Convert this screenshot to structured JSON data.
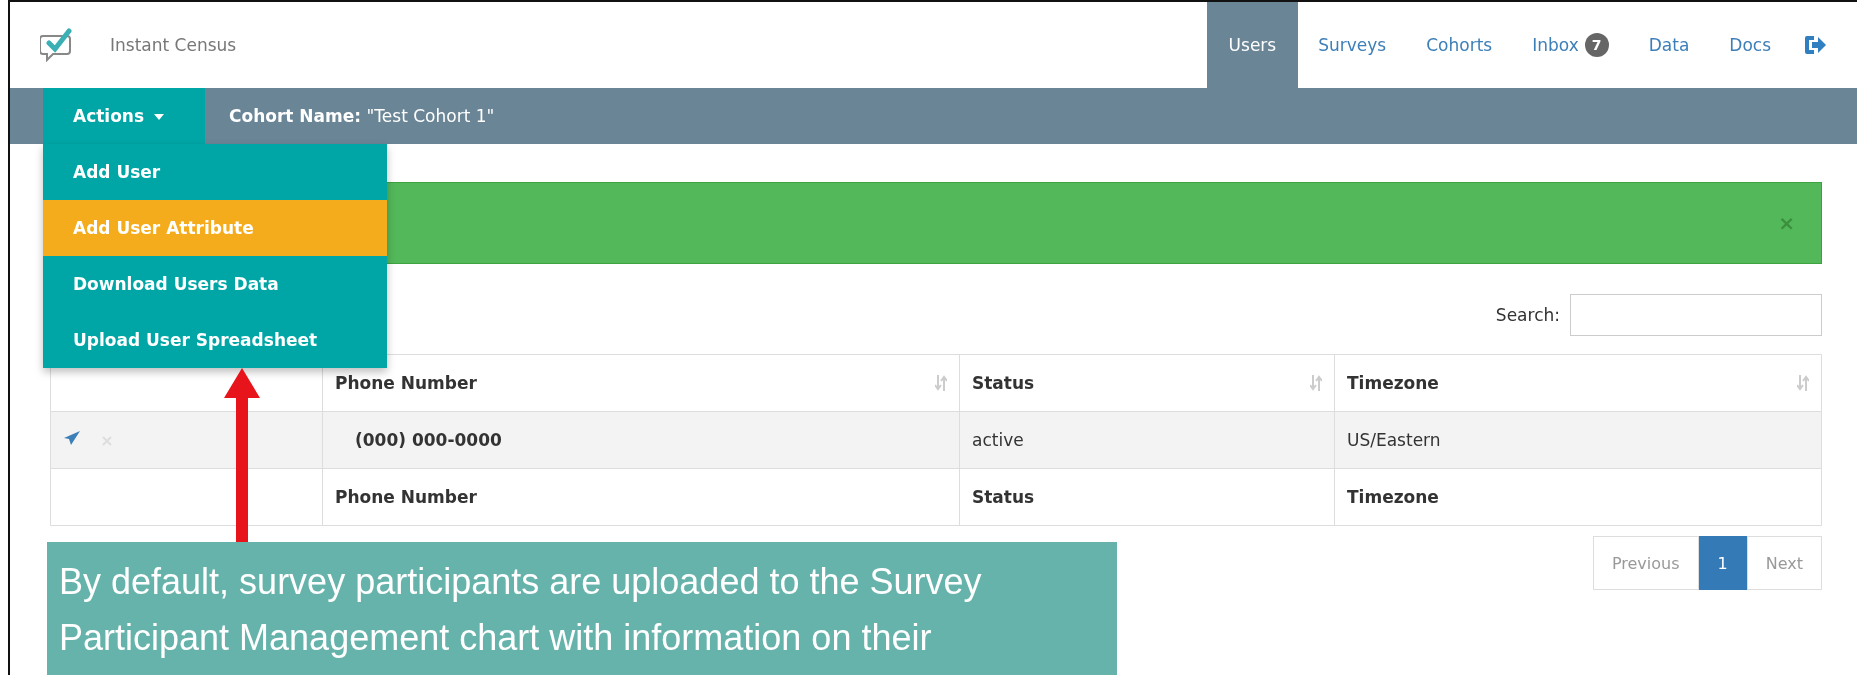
{
  "header": {
    "brand": "Instant Census"
  },
  "nav": [
    {
      "label": "Users",
      "selected": true
    },
    {
      "label": "Surveys",
      "selected": false
    },
    {
      "label": "Cohorts",
      "selected": false
    },
    {
      "label": "Inbox",
      "selected": false,
      "badge": "7"
    },
    {
      "label": "Data",
      "selected": false
    },
    {
      "label": "Docs",
      "selected": false
    }
  ],
  "subbar": {
    "actions": "Actions",
    "cohort_label": "Cohort Name:",
    "cohort_value": "\"Test Cohort 1\""
  },
  "actions_menu": [
    {
      "label": "Add User",
      "selected": false
    },
    {
      "label": "Add User Attribute",
      "selected": true
    },
    {
      "label": "Download Users Data",
      "selected": false
    },
    {
      "label": "Upload User Spreadsheet",
      "selected": false
    }
  ],
  "alert": {
    "close": "×"
  },
  "search": {
    "label": "Search:"
  },
  "table": {
    "columns": [
      "Phone Number",
      "Status",
      "Timezone"
    ],
    "rows": [
      {
        "phone": "(000) 000-0000",
        "status": "active",
        "timezone": "US/Eastern"
      }
    ],
    "footer": [
      "Phone Number",
      "Status",
      "Timezone"
    ]
  },
  "pagination": {
    "previous": "Previous",
    "pages": [
      {
        "label": "1",
        "selected": true
      }
    ],
    "next": "Next"
  },
  "callout": {
    "text": "By default, survey participants are uploaded to the Survey Participant Management chart with information on their"
  }
}
